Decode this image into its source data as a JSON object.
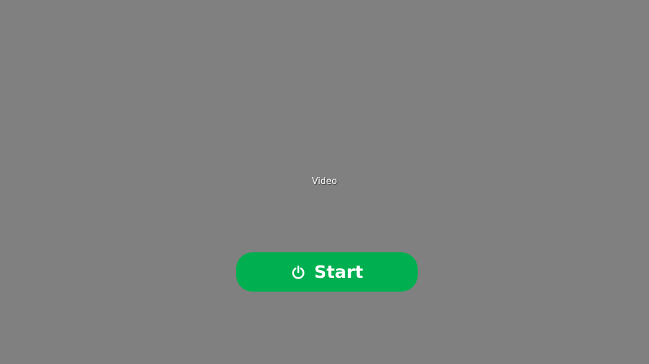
{
  "video": {
    "label": "Video",
    "background_color": "#808080"
  },
  "start_button": {
    "label": "Start",
    "icon": "power-icon",
    "color": "#00b050",
    "text_color": "#ffffff"
  }
}
